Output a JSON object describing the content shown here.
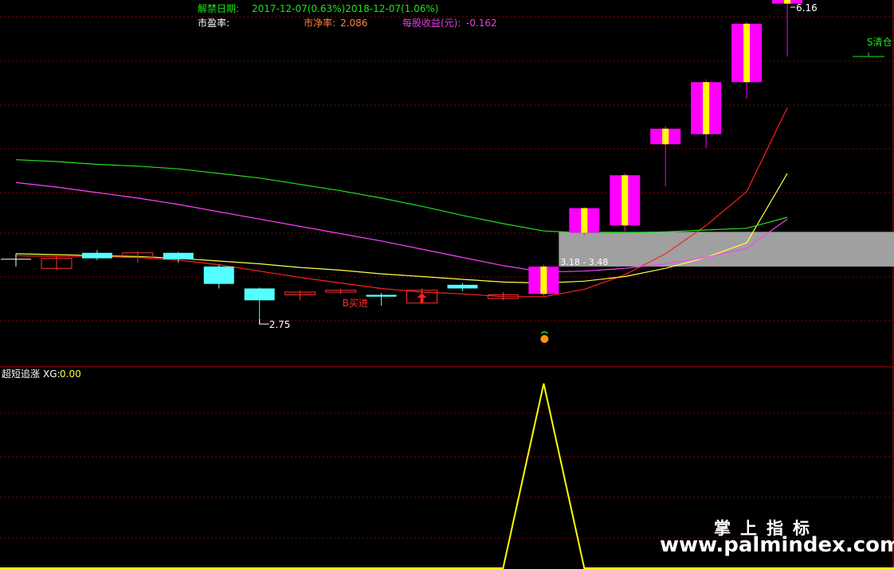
{
  "header": {
    "unlock_label": "解禁日期:",
    "unlock_value": "2017-12-07(0.63%)2018-12-07(1.06%)",
    "pe_label": "市盈率:",
    "pb_label": "市净率:",
    "pb_value": "2.086",
    "eps_label": "每股收益(元):",
    "eps_value": "-0.162"
  },
  "colors": {
    "up_candle": "#ff00ff",
    "up_candle_core": "#ffff00",
    "down_candle": "#54ffff",
    "small_candle_outline": "#ff3030",
    "ma_short": "#ff2020",
    "ma_mid": "#ffff40",
    "ma_long": "#ff40ff",
    "ma_longest": "#20e020",
    "grid": "#8b0000",
    "signal_line": "#ffff00"
  },
  "chart_data": [
    {
      "type": "candlestick",
      "title": "",
      "price_range": [
        2.3,
        6.3
      ],
      "candles": [
        {
          "open": 3.46,
          "close": 3.46,
          "high": 3.52,
          "low": 3.38,
          "style": "flat"
        },
        {
          "open": 3.47,
          "close": 3.36,
          "high": 3.5,
          "low": 3.34,
          "style": "hollow-red"
        },
        {
          "open": 3.53,
          "close": 3.47,
          "high": 3.56,
          "low": 3.45,
          "style": "cyan"
        },
        {
          "open": 3.48,
          "close": 3.53,
          "high": 3.55,
          "low": 3.42,
          "style": "small-red"
        },
        {
          "open": 3.53,
          "close": 3.46,
          "high": 3.54,
          "low": 3.42,
          "style": "cyan"
        },
        {
          "open": 3.38,
          "close": 3.19,
          "high": 3.4,
          "low": 3.14,
          "style": "cyan"
        },
        {
          "open": 3.14,
          "close": 3.01,
          "high": 3.15,
          "low": 2.75,
          "style": "cyan"
        },
        {
          "open": 3.07,
          "close": 3.1,
          "high": 3.12,
          "low": 3.01,
          "style": "small-red"
        },
        {
          "open": 3.1,
          "close": 3.12,
          "high": 3.14,
          "low": 3.08,
          "style": "small-red"
        },
        {
          "open": 3.07,
          "close": 3.05,
          "high": 3.09,
          "low": 2.95,
          "style": "cyan"
        },
        {
          "open": 2.98,
          "close": 3.12,
          "high": 3.14,
          "low": 2.97,
          "style": "hollow-red"
        },
        {
          "open": 3.14,
          "close": 3.18,
          "high": 3.2,
          "low": 3.11,
          "style": "cyan"
        },
        {
          "open": 3.03,
          "close": 3.07,
          "high": 3.1,
          "low": 3.01,
          "style": "small-red"
        },
        {
          "open": 3.08,
          "close": 3.38,
          "high": 3.4,
          "low": 3.06,
          "style": "up"
        },
        {
          "open": 3.75,
          "close": 4.02,
          "high": 4.03,
          "low": 3.72,
          "style": "up"
        },
        {
          "open": 3.83,
          "close": 4.38,
          "high": 4.4,
          "low": 3.77,
          "style": "up"
        },
        {
          "open": 4.72,
          "close": 4.89,
          "high": 4.92,
          "low": 4.26,
          "style": "up"
        },
        {
          "open": 4.83,
          "close": 5.4,
          "high": 5.43,
          "low": 4.68,
          "style": "up"
        },
        {
          "open": 5.4,
          "close": 6.04,
          "high": 6.06,
          "low": 5.22,
          "style": "up"
        },
        {
          "open": 6.26,
          "close": 6.45,
          "high": 6.47,
          "low": 5.68,
          "style": "up"
        }
      ],
      "moving_averages": [
        {
          "color_key": "ma_short",
          "values": [
            3.5,
            3.49,
            3.49,
            3.48,
            3.45,
            3.4,
            3.33,
            3.26,
            3.2,
            3.14,
            3.1,
            3.08,
            3.05,
            3.05,
            3.13,
            3.29,
            3.52,
            3.83,
            4.2,
            5.12
          ]
        },
        {
          "color_key": "ma_mid",
          "values": [
            3.52,
            3.51,
            3.5,
            3.49,
            3.47,
            3.44,
            3.41,
            3.37,
            3.34,
            3.3,
            3.27,
            3.24,
            3.21,
            3.2,
            3.22,
            3.27,
            3.36,
            3.48,
            3.64,
            4.4
          ]
        },
        {
          "color_key": "ma_long",
          "values": [
            4.3,
            4.25,
            4.19,
            4.13,
            4.06,
            3.98,
            3.9,
            3.82,
            3.74,
            3.66,
            3.57,
            3.48,
            3.39,
            3.32,
            3.33,
            3.36,
            3.41,
            3.48,
            3.58,
            3.9
          ]
        },
        {
          "color_key": "ma_longest",
          "values": [
            4.55,
            4.53,
            4.5,
            4.48,
            4.45,
            4.4,
            4.35,
            4.28,
            4.21,
            4.13,
            4.04,
            3.94,
            3.85,
            3.77,
            3.75,
            3.75,
            3.76,
            3.78,
            3.8,
            3.92
          ]
        }
      ],
      "price_band": {
        "from_index": 13,
        "low": 3.38,
        "high": 3.76
      },
      "annotations": [
        {
          "index": 6,
          "price": 2.75,
          "text": "2.75",
          "color": "#ffffff"
        },
        {
          "index": 8,
          "price": 2.98,
          "text": "B买进",
          "color": "#ff3030"
        },
        {
          "index": 13,
          "price": 3.43,
          "text": "3.18 - 3.48",
          "color": "#ffffff"
        },
        {
          "index": 19,
          "price": 6.45,
          "text": "6.16",
          "color": "#ffffff"
        },
        {
          "index": 19,
          "price": 5.85,
          "text": "S清仓",
          "color": "#20e020"
        }
      ],
      "buy_arrow_index": 10
    },
    {
      "type": "line",
      "title": "超短追涨",
      "indicator_label": "XG:",
      "indicator_value": "0.00",
      "ylim": [
        0,
        1
      ],
      "values": [
        0,
        0,
        0,
        0,
        0,
        0,
        0,
        0,
        0,
        0,
        0,
        0,
        0,
        1,
        0,
        0,
        0,
        0,
        0,
        0
      ]
    }
  ],
  "watermark": {
    "title": "掌上指标",
    "url": "www.palmindex.com"
  }
}
